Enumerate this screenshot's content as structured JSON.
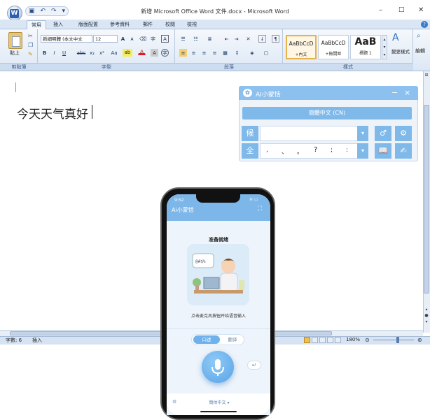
{
  "word": {
    "title": "新增 Microsoft Office Word 文件.docx - Microsoft Word",
    "tabs": [
      "常用",
      "插入",
      "版面配置",
      "參考資料",
      "郵件",
      "校閱",
      "檢視"
    ],
    "font_name": "新細明體 (本文中文",
    "font_size": "12",
    "group_labels": {
      "clipboard": "剪貼簿",
      "font": "字型",
      "paragraph": "段落",
      "styles": "樣式"
    },
    "clipboard": {
      "paste": "貼上"
    },
    "styles": [
      {
        "sample": "AaBbCcD",
        "name": "+內文"
      },
      {
        "sample": "AaBbCcD",
        "name": "+無間距"
      },
      {
        "sample": "AaB",
        "name": "標題 1"
      }
    ],
    "change_styles": "變更樣式",
    "edit": "編輯",
    "document_text": "今天天气真好",
    "status": {
      "words": "字數: 6",
      "mode": "插入",
      "zoom": "180%"
    },
    "colors": {
      "ribbon": "#dde8f5",
      "accent": "#2e5fae"
    }
  },
  "ime": {
    "title": "AI小蒙恬",
    "minimize": "−",
    "close": "×",
    "language": "簡體中文 (CN)",
    "candidate_label": "候",
    "punct_label": "全",
    "punctuation": [
      ",",
      "、",
      "。",
      "?",
      ";",
      ":"
    ],
    "color": "#7fb9ea"
  },
  "phone": {
    "time": "9:52",
    "app_title": "Ai小蒙恬",
    "status_text": "准备就绪",
    "hint": "点击麦克风按钮开始语音输入",
    "toggle": [
      "口述",
      "翻译"
    ],
    "bottom_lang": "簡体中文",
    "bubble": "@#$%"
  }
}
